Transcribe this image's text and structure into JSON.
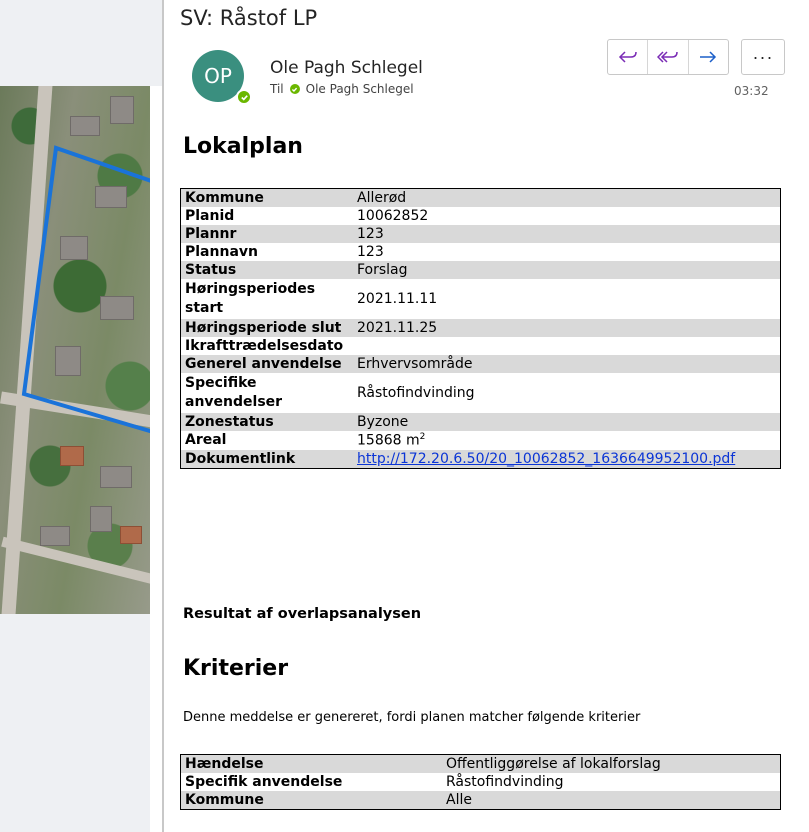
{
  "email": {
    "subject": "SV: Råstof LP",
    "avatar_initials": "OP",
    "sender_name": "Ole Pagh Schlegel",
    "to_label": "Til",
    "recipient": "Ole Pagh Schlegel",
    "time": "03:32",
    "actions": {
      "reply_icon": "reply-icon",
      "reply_all_icon": "reply-all-icon",
      "forward_icon": "forward-icon",
      "more_label": "···"
    }
  },
  "body": {
    "heading_lokalplan": "Lokalplan",
    "plan_table": [
      {
        "key": "Kommune",
        "value": "Allerød"
      },
      {
        "key": "Planid",
        "value": "10062852"
      },
      {
        "key": "Plannr",
        "value": "123"
      },
      {
        "key": "Plannavn",
        "value": "123"
      },
      {
        "key": "Status",
        "value": "Forslag"
      },
      {
        "key": "Høringsperiodes start",
        "value": "2021.11.11"
      },
      {
        "key": "Høringsperiode slut",
        "value": "2021.11.25"
      },
      {
        "key": "Ikrafttrædelsesdato",
        "value": ""
      },
      {
        "key": "Generel anvendelse",
        "value": "Erhvervsområde"
      },
      {
        "key": "Specifike anvendelser",
        "value": "Råstofindvinding"
      },
      {
        "key": "Zonestatus",
        "value": "Byzone"
      },
      {
        "key": "Areal",
        "value": "15868 m",
        "sup": "2"
      },
      {
        "key": "Dokumentlink",
        "value": "http://172.20.6.50/20_10062852_1636649952100.pdf"
      }
    ],
    "result_heading": "Resultat af overlapsanalysen",
    "heading_kriterier": "Kriterier",
    "criteria_message": "Denne meddelse er genereret, fordi planen matcher følgende kriterier",
    "criteria_table": [
      {
        "key": "Hændelse",
        "value": "Offentliggørelse af lokalforslag"
      },
      {
        "key": "Specifik anvendelse",
        "value": "Råstofindvinding"
      },
      {
        "key": "Kommune",
        "value": "Alle"
      }
    ]
  },
  "colors": {
    "avatar": "#3a8f7f",
    "presence": "#6bb700",
    "action_icons": "#7a2bb5",
    "link": "#0b35d6",
    "row_shade": "#d9d9d9"
  }
}
